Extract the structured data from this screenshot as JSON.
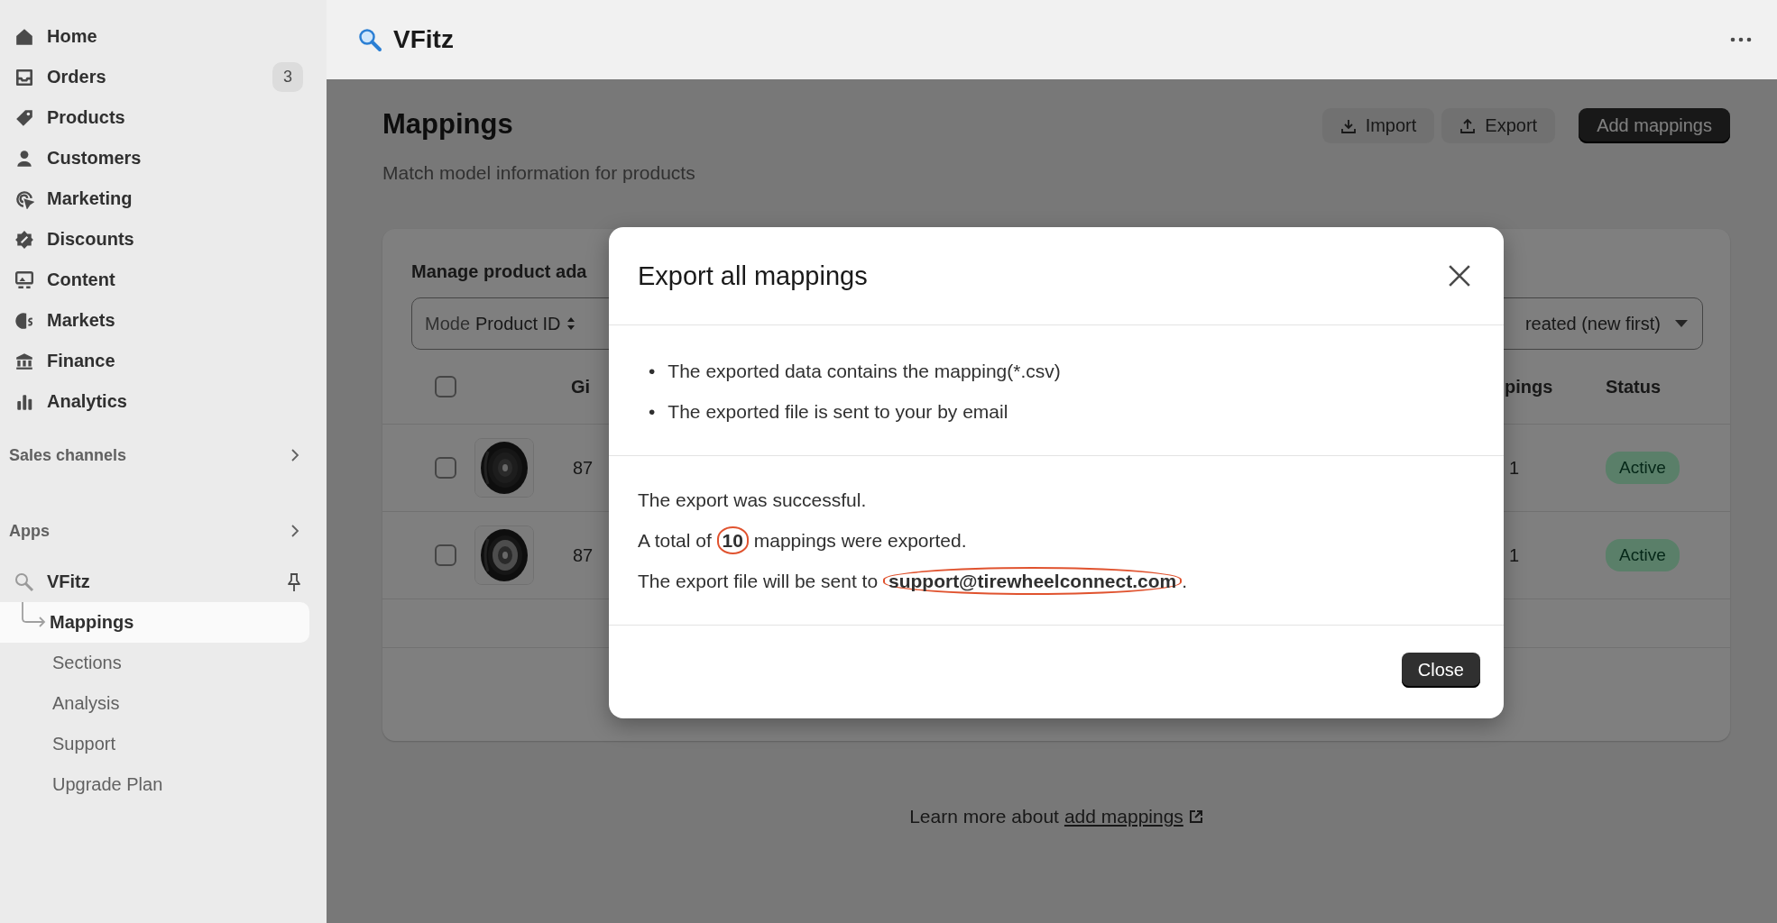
{
  "sidebar": {
    "nav": [
      {
        "label": "Home"
      },
      {
        "label": "Orders",
        "badge": "3"
      },
      {
        "label": "Products"
      },
      {
        "label": "Customers"
      },
      {
        "label": "Marketing"
      },
      {
        "label": "Discounts"
      },
      {
        "label": "Content"
      },
      {
        "label": "Markets"
      },
      {
        "label": "Finance"
      },
      {
        "label": "Analytics"
      }
    ],
    "sections": [
      {
        "label": "Sales channels"
      },
      {
        "label": "Apps"
      }
    ],
    "app": {
      "name": "VFitz",
      "pages": [
        {
          "label": "Mappings",
          "selected": true
        },
        {
          "label": "Sections",
          "selected": false
        },
        {
          "label": "Analysis",
          "selected": false
        },
        {
          "label": "Support",
          "selected": false
        },
        {
          "label": "Upgrade Plan",
          "selected": false
        }
      ]
    }
  },
  "top_bar": {
    "app_name": "VFitz"
  },
  "page": {
    "title": "Mappings",
    "subtitle": "Match model information for products",
    "actions": [
      {
        "label": "Import",
        "kind": "secondary"
      },
      {
        "label": "Export",
        "kind": "secondary"
      },
      {
        "label": "Add mappings",
        "kind": "primary"
      }
    ]
  },
  "card": {
    "title": "Manage product ada",
    "filter": {
      "label": "Mode",
      "value": "Product ID"
    },
    "sort": {
      "value": "reated (new first)"
    },
    "header_checked": false,
    "columns_left": [
      "Gi"
    ],
    "columns_right": [
      "pings",
      "Status"
    ],
    "rows": [
      {
        "checked": false,
        "cell": "87",
        "mappings": "1",
        "status": "Active"
      },
      {
        "checked": false,
        "cell": "87",
        "mappings": "1",
        "status": "Active"
      }
    ]
  },
  "modal": {
    "title": "Export all mappings",
    "notes": [
      {
        "bullet": "•",
        "text": "The exported data contains the mapping(*.csv)"
      },
      {
        "bullet": "•",
        "text": "The exported file is sent to your by email"
      }
    ],
    "messages": [
      {
        "text": "The export was successful."
      },
      {
        "text": "A total of **10** mappings were exported.",
        "circled": true
      },
      {
        "text": "The export file will be sent to **support@tirewheelconnect.com**.",
        "circled": true
      }
    ],
    "close_button": "Close"
  },
  "footer": {
    "text": "Learn more about",
    "link": "add mappings"
  }
}
